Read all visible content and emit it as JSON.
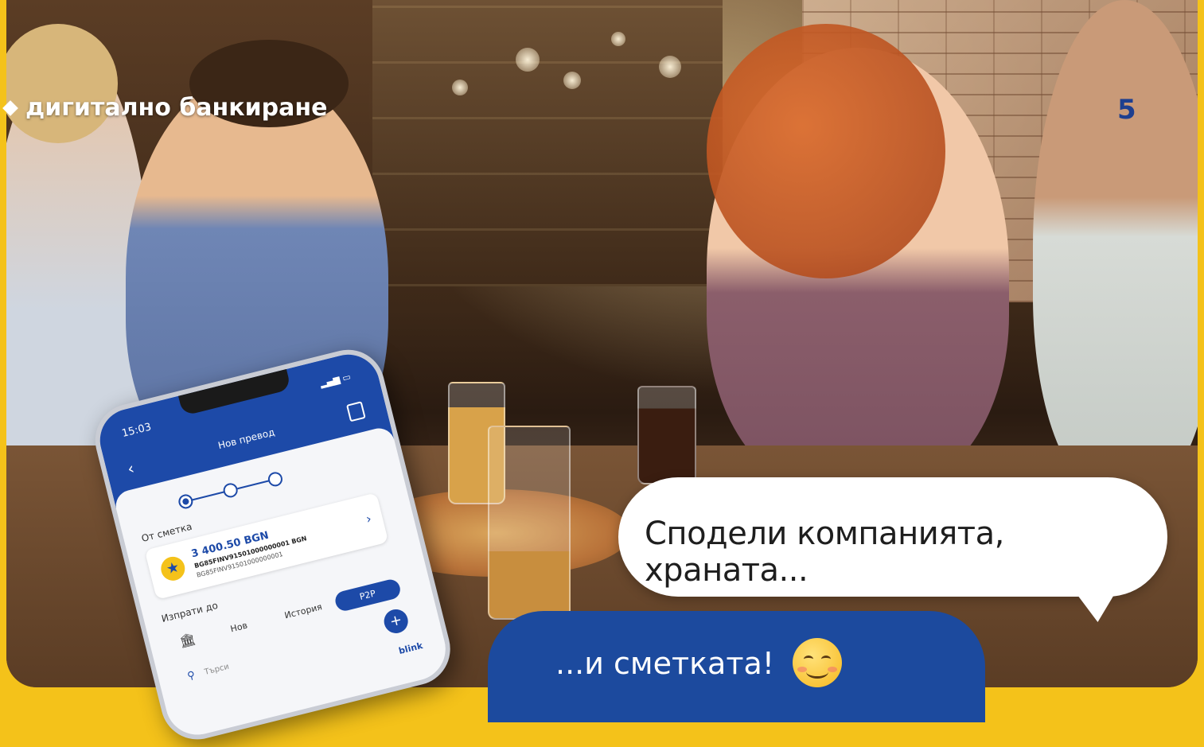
{
  "header": {
    "section_title": "дигитално банкиране",
    "page_number": "5"
  },
  "phone": {
    "status_time": "15:03",
    "screen_title": "Нов превод",
    "from_label": "От сметка",
    "account": {
      "amount": "3 400.50 BGN",
      "iban_primary": "BG85FINV91501000000001 BGN",
      "iban_secondary": "BG85FINV91501000000001"
    },
    "send_to_label": "Изпрати до",
    "tabs": [
      {
        "label": "Нов"
      },
      {
        "label": "История"
      },
      {
        "label": "P2P"
      }
    ],
    "active_tab": "P2P",
    "search": {
      "placeholder": "Търси"
    },
    "brand": "blink"
  },
  "bubbles": {
    "white_text": "Сподели компанията, храната...",
    "blue_text": "...и сметката!"
  },
  "icons": {
    "back": "chevron-left-icon",
    "receipt": "receipt-icon",
    "star": "star-icon",
    "chevron": "chevron-right-icon",
    "home": "bank-icon",
    "search": "search-icon",
    "add": "plus-icon",
    "smiley": "smiley-emoji-icon"
  },
  "colors": {
    "brand_blue": "#1d4aa8",
    "brand_yellow": "#f4c21a",
    "bubble_blue": "#1c4a9e"
  }
}
